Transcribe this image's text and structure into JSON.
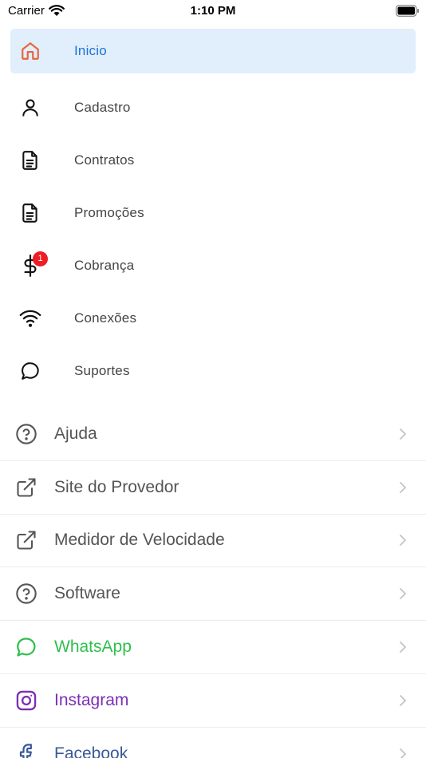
{
  "status_bar": {
    "carrier": "Carrier",
    "time": "1:10 PM"
  },
  "menu": {
    "items": [
      {
        "label": "Inicio",
        "icon": "home-icon",
        "active": true
      },
      {
        "label": "Cadastro",
        "icon": "user-icon"
      },
      {
        "label": "Contratos",
        "icon": "document-icon"
      },
      {
        "label": "Promoções",
        "icon": "document-icon"
      },
      {
        "label": "Cobrança",
        "icon": "dollar-icon",
        "badge": "1"
      },
      {
        "label": "Conexões",
        "icon": "wifi-icon"
      },
      {
        "label": "Suportes",
        "icon": "chat-icon"
      }
    ]
  },
  "links": {
    "items": [
      {
        "label": "Ajuda",
        "icon": "help-circle-icon"
      },
      {
        "label": "Site do Provedor",
        "icon": "external-link-icon"
      },
      {
        "label": "Medidor de Velocidade",
        "icon": "external-link-icon"
      },
      {
        "label": "Software",
        "icon": "help-circle-icon"
      },
      {
        "label": "WhatsApp",
        "icon": "whatsapp-icon",
        "color": "#2fbf4d"
      },
      {
        "label": "Instagram",
        "icon": "instagram-icon",
        "color": "#7b2fb5"
      },
      {
        "label": "Facebook",
        "icon": "facebook-icon",
        "color": "#3b5998"
      }
    ]
  },
  "colors": {
    "active_bg": "#e1eefb",
    "active_text": "#1a73d9",
    "home_icon": "#e8663d",
    "badge": "#ee1c25",
    "chevron": "#c4c4c4"
  }
}
